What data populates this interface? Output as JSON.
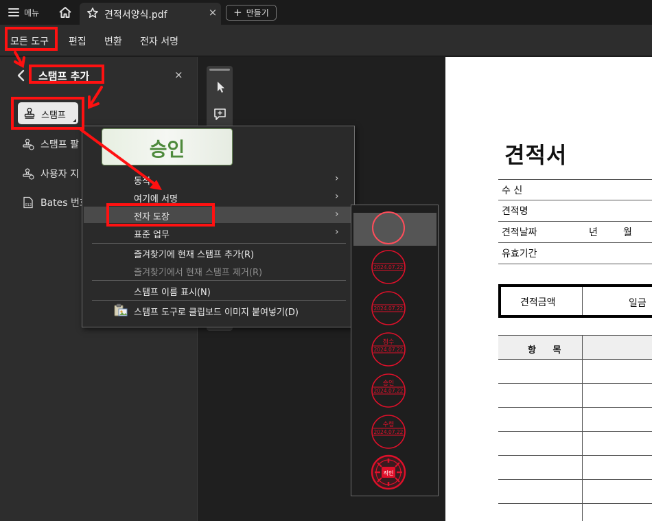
{
  "app": {
    "menu_label": "메뉴",
    "tab_title": "견적서양식.pdf",
    "tab_close": "×",
    "new_label": "만들기",
    "new_plus": "+"
  },
  "toolbar": {
    "items": [
      "모든 도구",
      "편집",
      "변환",
      "전자 서명"
    ]
  },
  "panel": {
    "title": "스탬프 추가",
    "close": "×",
    "stamp_button": "스탬프",
    "items": [
      "스탬프 팔",
      "사용자 지",
      "Bates 번호"
    ]
  },
  "preview": {
    "text": "승인"
  },
  "context_menu": {
    "items": [
      {
        "label": "동적",
        "submenu": true
      },
      {
        "label": "여기에 서명",
        "submenu": true
      },
      {
        "label": "전자 도장",
        "submenu": true,
        "highlighted": true
      },
      {
        "label": "표준 업무",
        "submenu": true
      },
      {
        "label": "즐겨찾기에 현재 스탬프 추가(R)"
      },
      {
        "label": "즐겨찾기에서 현재 스탬프 제거(R)",
        "disabled": true
      },
      {
        "label": "스탬프 이름 표시(N)"
      },
      {
        "label": "스탬프 도구로 클립보드 이미지 붙여넣기(D)"
      }
    ],
    "arrow": "›"
  },
  "stamps": {
    "items": [
      {
        "top": "",
        "date": ""
      },
      {
        "top": "",
        "date": "2024.07.22"
      },
      {
        "top": "",
        "date": "2024.07.22"
      },
      {
        "top": "접수",
        "date": "2024.07.22"
      },
      {
        "top": "승인",
        "date": "2024.07.22"
      },
      {
        "top": "수령",
        "date": "2024.07.22"
      }
    ],
    "seal_text": "직인",
    "stamp_color": "#e0102a"
  },
  "document": {
    "title": "견적서",
    "rows": [
      {
        "label": "수  신",
        "v1": "",
        "v2": ""
      },
      {
        "label": "견적명",
        "v1": "",
        "v2": ""
      },
      {
        "label": "견적날짜",
        "v1": "년",
        "v2": "월"
      },
      {
        "label": "유효기간",
        "v1": "",
        "v2": ""
      }
    ],
    "amount_label": "견적금액",
    "amount_value": "일금",
    "items_header": "항 목"
  },
  "colors": {
    "annotation_red": "#ff1111",
    "approval_green": "#4e8a3c"
  }
}
